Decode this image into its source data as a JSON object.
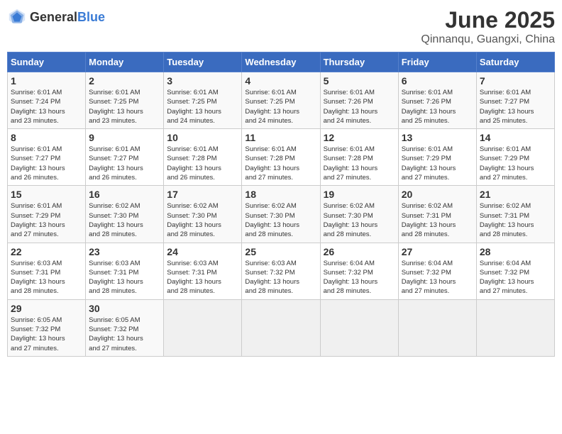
{
  "header": {
    "logo_general": "General",
    "logo_blue": "Blue",
    "title": "June 2025",
    "subtitle": "Qinnanqu, Guangxi, China"
  },
  "calendar": {
    "columns": [
      "Sunday",
      "Monday",
      "Tuesday",
      "Wednesday",
      "Thursday",
      "Friday",
      "Saturday"
    ],
    "weeks": [
      [
        {
          "day": "",
          "info": ""
        },
        {
          "day": "2",
          "info": "Sunrise: 6:01 AM\nSunset: 7:25 PM\nDaylight: 13 hours\nand 23 minutes."
        },
        {
          "day": "3",
          "info": "Sunrise: 6:01 AM\nSunset: 7:25 PM\nDaylight: 13 hours\nand 24 minutes."
        },
        {
          "day": "4",
          "info": "Sunrise: 6:01 AM\nSunset: 7:25 PM\nDaylight: 13 hours\nand 24 minutes."
        },
        {
          "day": "5",
          "info": "Sunrise: 6:01 AM\nSunset: 7:26 PM\nDaylight: 13 hours\nand 24 minutes."
        },
        {
          "day": "6",
          "info": "Sunrise: 6:01 AM\nSunset: 7:26 PM\nDaylight: 13 hours\nand 25 minutes."
        },
        {
          "day": "7",
          "info": "Sunrise: 6:01 AM\nSunset: 7:27 PM\nDaylight: 13 hours\nand 25 minutes."
        }
      ],
      [
        {
          "day": "1",
          "info": "Sunrise: 6:01 AM\nSunset: 7:24 PM\nDaylight: 13 hours\nand 23 minutes."
        },
        {
          "day": "9",
          "info": "Sunrise: 6:01 AM\nSunset: 7:27 PM\nDaylight: 13 hours\nand 26 minutes."
        },
        {
          "day": "10",
          "info": "Sunrise: 6:01 AM\nSunset: 7:28 PM\nDaylight: 13 hours\nand 26 minutes."
        },
        {
          "day": "11",
          "info": "Sunrise: 6:01 AM\nSunset: 7:28 PM\nDaylight: 13 hours\nand 27 minutes."
        },
        {
          "day": "12",
          "info": "Sunrise: 6:01 AM\nSunset: 7:28 PM\nDaylight: 13 hours\nand 27 minutes."
        },
        {
          "day": "13",
          "info": "Sunrise: 6:01 AM\nSunset: 7:29 PM\nDaylight: 13 hours\nand 27 minutes."
        },
        {
          "day": "14",
          "info": "Sunrise: 6:01 AM\nSunset: 7:29 PM\nDaylight: 13 hours\nand 27 minutes."
        }
      ],
      [
        {
          "day": "8",
          "info": "Sunrise: 6:01 AM\nSunset: 7:27 PM\nDaylight: 13 hours\nand 26 minutes."
        },
        {
          "day": "16",
          "info": "Sunrise: 6:02 AM\nSunset: 7:30 PM\nDaylight: 13 hours\nand 28 minutes."
        },
        {
          "day": "17",
          "info": "Sunrise: 6:02 AM\nSunset: 7:30 PM\nDaylight: 13 hours\nand 28 minutes."
        },
        {
          "day": "18",
          "info": "Sunrise: 6:02 AM\nSunset: 7:30 PM\nDaylight: 13 hours\nand 28 minutes."
        },
        {
          "day": "19",
          "info": "Sunrise: 6:02 AM\nSunset: 7:30 PM\nDaylight: 13 hours\nand 28 minutes."
        },
        {
          "day": "20",
          "info": "Sunrise: 6:02 AM\nSunset: 7:31 PM\nDaylight: 13 hours\nand 28 minutes."
        },
        {
          "day": "21",
          "info": "Sunrise: 6:02 AM\nSunset: 7:31 PM\nDaylight: 13 hours\nand 28 minutes."
        }
      ],
      [
        {
          "day": "15",
          "info": "Sunrise: 6:01 AM\nSunset: 7:29 PM\nDaylight: 13 hours\nand 27 minutes."
        },
        {
          "day": "23",
          "info": "Sunrise: 6:03 AM\nSunset: 7:31 PM\nDaylight: 13 hours\nand 28 minutes."
        },
        {
          "day": "24",
          "info": "Sunrise: 6:03 AM\nSunset: 7:31 PM\nDaylight: 13 hours\nand 28 minutes."
        },
        {
          "day": "25",
          "info": "Sunrise: 6:03 AM\nSunset: 7:32 PM\nDaylight: 13 hours\nand 28 minutes."
        },
        {
          "day": "26",
          "info": "Sunrise: 6:04 AM\nSunset: 7:32 PM\nDaylight: 13 hours\nand 28 minutes."
        },
        {
          "day": "27",
          "info": "Sunrise: 6:04 AM\nSunset: 7:32 PM\nDaylight: 13 hours\nand 27 minutes."
        },
        {
          "day": "28",
          "info": "Sunrise: 6:04 AM\nSunset: 7:32 PM\nDaylight: 13 hours\nand 27 minutes."
        }
      ],
      [
        {
          "day": "22",
          "info": "Sunrise: 6:03 AM\nSunset: 7:31 PM\nDaylight: 13 hours\nand 28 minutes."
        },
        {
          "day": "30",
          "info": "Sunrise: 6:05 AM\nSunset: 7:32 PM\nDaylight: 13 hours\nand 27 minutes."
        },
        {
          "day": "",
          "info": ""
        },
        {
          "day": "",
          "info": ""
        },
        {
          "day": "",
          "info": ""
        },
        {
          "day": "",
          "info": ""
        },
        {
          "day": "",
          "info": ""
        }
      ],
      [
        {
          "day": "29",
          "info": "Sunrise: 6:05 AM\nSunset: 7:32 PM\nDaylight: 13 hours\nand 27 minutes."
        },
        {
          "day": "",
          "info": ""
        },
        {
          "day": "",
          "info": ""
        },
        {
          "day": "",
          "info": ""
        },
        {
          "day": "",
          "info": ""
        },
        {
          "day": "",
          "info": ""
        },
        {
          "day": "",
          "info": ""
        }
      ]
    ]
  }
}
